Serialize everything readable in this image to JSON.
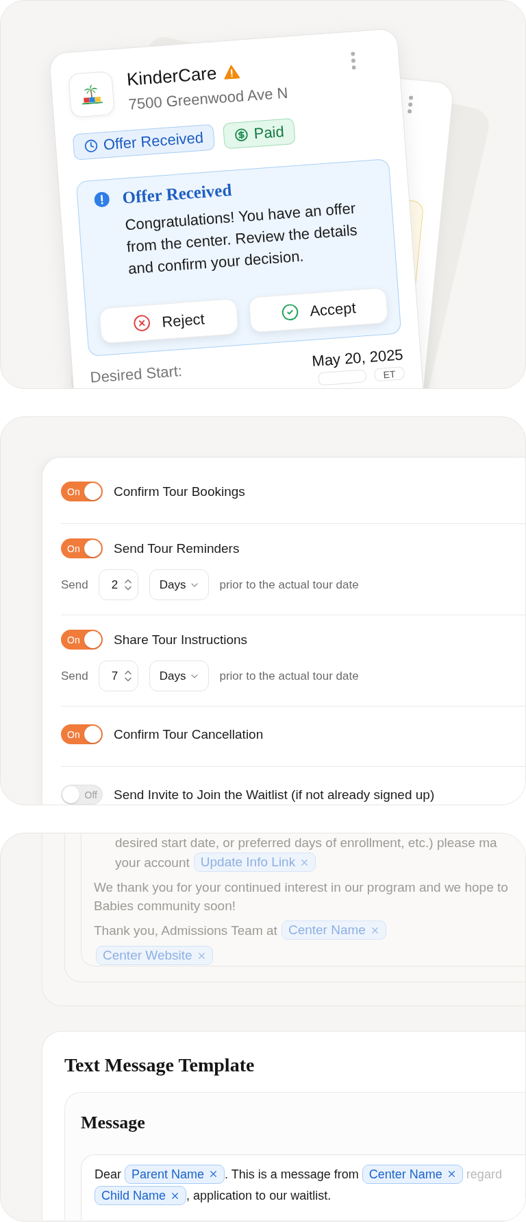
{
  "offer_card": {
    "center_name": "KinderCare",
    "warning": true,
    "address": "7500 Greenwood Ave N",
    "badges": [
      {
        "kind": "status",
        "label": "Offer Received"
      },
      {
        "kind": "payment",
        "label": "Paid"
      }
    ],
    "alert": {
      "title": "Offer Received",
      "lines": [
        "Congratulations! You have an offer",
        "from the center. Review the details",
        "and confirm your decision."
      ],
      "buttons": [
        {
          "kind": "reject",
          "label": "Reject"
        },
        {
          "kind": "accept",
          "label": "Accept"
        }
      ]
    },
    "desired_start": {
      "label": "Desired Start:",
      "value": "May 20, 2025",
      "timezone": "ET"
    }
  },
  "tour_settings": {
    "rows": [
      {
        "kind": "toggle",
        "label": "Confirm Tour Bookings",
        "on": true,
        "switch_text": "On"
      },
      {
        "kind": "schedule",
        "label": "Send Tour Reminders",
        "on": true,
        "switch_text": "On",
        "send_label": "Send",
        "count": "2",
        "unit": "Days",
        "suffix": "prior to the actual tour date"
      },
      {
        "kind": "schedule",
        "label": "Share Tour Instructions",
        "on": true,
        "switch_text": "On",
        "send_label": "Send",
        "count": "7",
        "unit": "Days",
        "suffix": "prior to the actual tour date"
      },
      {
        "kind": "toggle",
        "label": "Confirm Tour Cancellation",
        "on": true,
        "switch_text": "On"
      },
      {
        "kind": "toggle",
        "label": "Send Invite to Join the Waitlist (if not already signed up)",
        "on": false,
        "switch_text": "Off"
      }
    ]
  },
  "email_preview": {
    "partial_line": "desired start date, or preferred days of enrollment, etc.) please ma",
    "account_line": {
      "text": "your account",
      "tag": "Update Info Link"
    },
    "closing_lines": [
      "We thank you for your continued interest in our program and we hope to",
      "Babies community soon!"
    ],
    "signature": {
      "text": "Thank you, Admissions Team at",
      "tags": [
        "Center Name",
        "Center Website"
      ]
    }
  },
  "text_message_template": {
    "title": "Text Message Template",
    "section_title": "Message",
    "lines": [
      [
        {
          "kind": "text",
          "text": "Dear "
        },
        {
          "kind": "tag",
          "text": "Parent Name"
        },
        {
          "kind": "text",
          "text": ". This is a message from "
        },
        {
          "kind": "tag",
          "text": "Center Name"
        },
        {
          "kind": "text",
          "text": " regard",
          "faded": true
        }
      ],
      [
        {
          "kind": "tag",
          "text": "Child Name"
        },
        {
          "kind": "text",
          "text": ", application to our waitlist."
        }
      ]
    ]
  }
}
